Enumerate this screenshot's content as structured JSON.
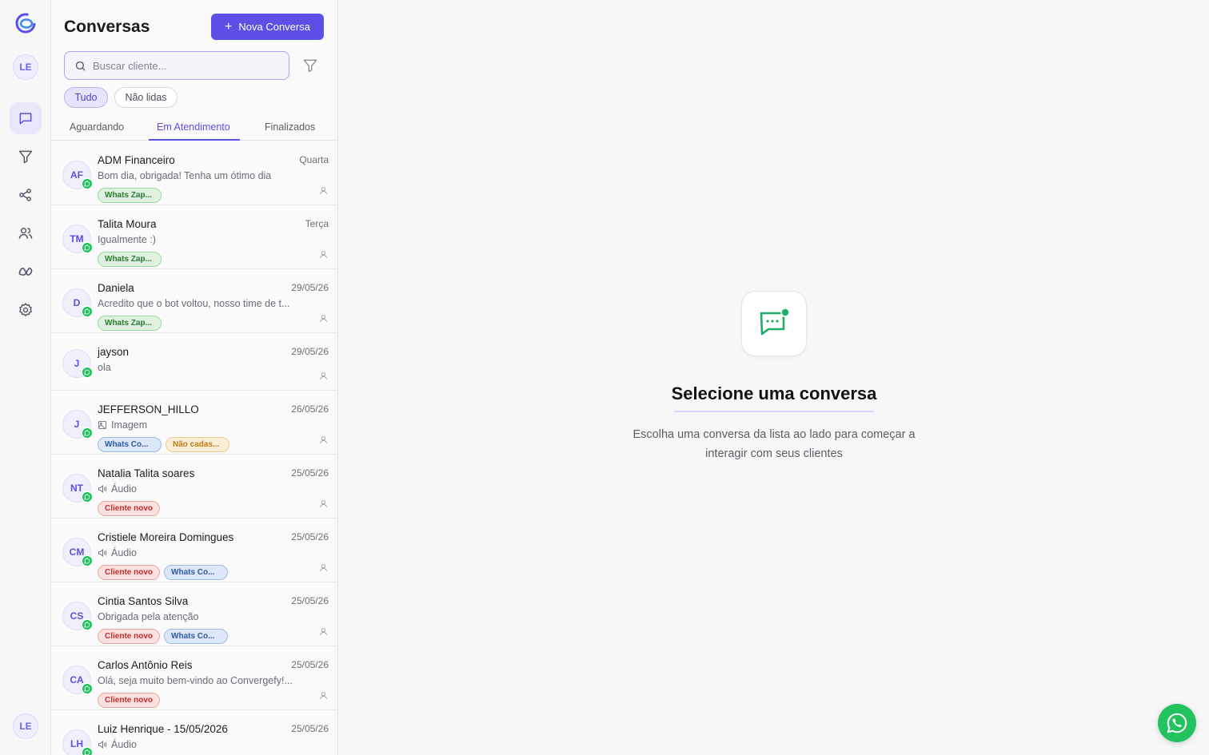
{
  "rail": {
    "user_initials": "LE",
    "bottom_user_initials": "LE"
  },
  "panel": {
    "title": "Conversas",
    "new_button_label": "Nova Conversa",
    "search_placeholder": "Buscar cliente...",
    "chips": {
      "all": "Tudo",
      "unread": "Não lidas"
    },
    "tabs": [
      "Aguardando",
      "Em Atendimento",
      "Finalizados"
    ],
    "active_tab": "Em Atendimento"
  },
  "conversations": [
    {
      "initials": "AF",
      "name": "ADM Financeiro",
      "date": "Quarta",
      "message": "Bom dia, obrigada! Tenha um ótimo dia",
      "tags": [
        {
          "label": "Whats Zap...",
          "color": "green"
        }
      ]
    },
    {
      "initials": "TM",
      "name": "Talita Moura",
      "date": "Terça",
      "message": "Igualmente :)",
      "tags": [
        {
          "label": "Whats Zap...",
          "color": "green"
        }
      ]
    },
    {
      "initials": "D",
      "name": "Daniela",
      "date": "29/05/26",
      "message": "Acredito que o bot voltou, nosso time de t...",
      "tags": [
        {
          "label": "Whats Zap...",
          "color": "green"
        }
      ]
    },
    {
      "initials": "J",
      "name": "jayson",
      "date": "29/05/26",
      "message": "ola",
      "tags": []
    },
    {
      "initials": "J",
      "name": "JEFFERSON_HILLO",
      "date": "26/05/26",
      "message": "Imagem",
      "msg_icon": "image-icon",
      "tags": [
        {
          "label": "Whats Co...",
          "color": "blue"
        },
        {
          "label": "Não cadas...",
          "color": "orange"
        }
      ]
    },
    {
      "initials": "NT",
      "name": "Natalia Talita soares",
      "date": "25/05/26",
      "message": "Áudio",
      "msg_icon": "audio-icon",
      "tags": [
        {
          "label": "Cliente novo",
          "color": "red"
        }
      ]
    },
    {
      "initials": "CM",
      "name": "Cristiele Moreira Domingues",
      "date": "25/05/26",
      "message": "Áudio",
      "msg_icon": "audio-icon",
      "tags": [
        {
          "label": "Cliente novo",
          "color": "red"
        },
        {
          "label": "Whats Co...",
          "color": "blue"
        }
      ]
    },
    {
      "initials": "CS",
      "name": "Cintia Santos Silva",
      "date": "25/05/26",
      "message": "Obrigada pela atenção",
      "tags": [
        {
          "label": "Cliente novo",
          "color": "red"
        },
        {
          "label": "Whats Co...",
          "color": "blue"
        }
      ]
    },
    {
      "initials": "CA",
      "name": "Carlos Antônio Reis",
      "date": "25/05/26",
      "message": "Olá, seja muito bem-vindo ao Convergefy!...",
      "tags": [
        {
          "label": "Cliente novo",
          "color": "red"
        }
      ]
    },
    {
      "initials": "LH",
      "name": "Luiz Henrique - 15/05/2026",
      "date": "25/05/26",
      "message": "Áudio",
      "msg_icon": "audio-icon",
      "tags": []
    }
  ],
  "empty_state": {
    "title": "Selecione uma conversa",
    "subtitle": "Escolha uma conversa da lista ao lado para começar a interagir com seus clientes"
  },
  "colors": {
    "accent": "#5b4fe5",
    "whatsapp": "#22c35e"
  }
}
